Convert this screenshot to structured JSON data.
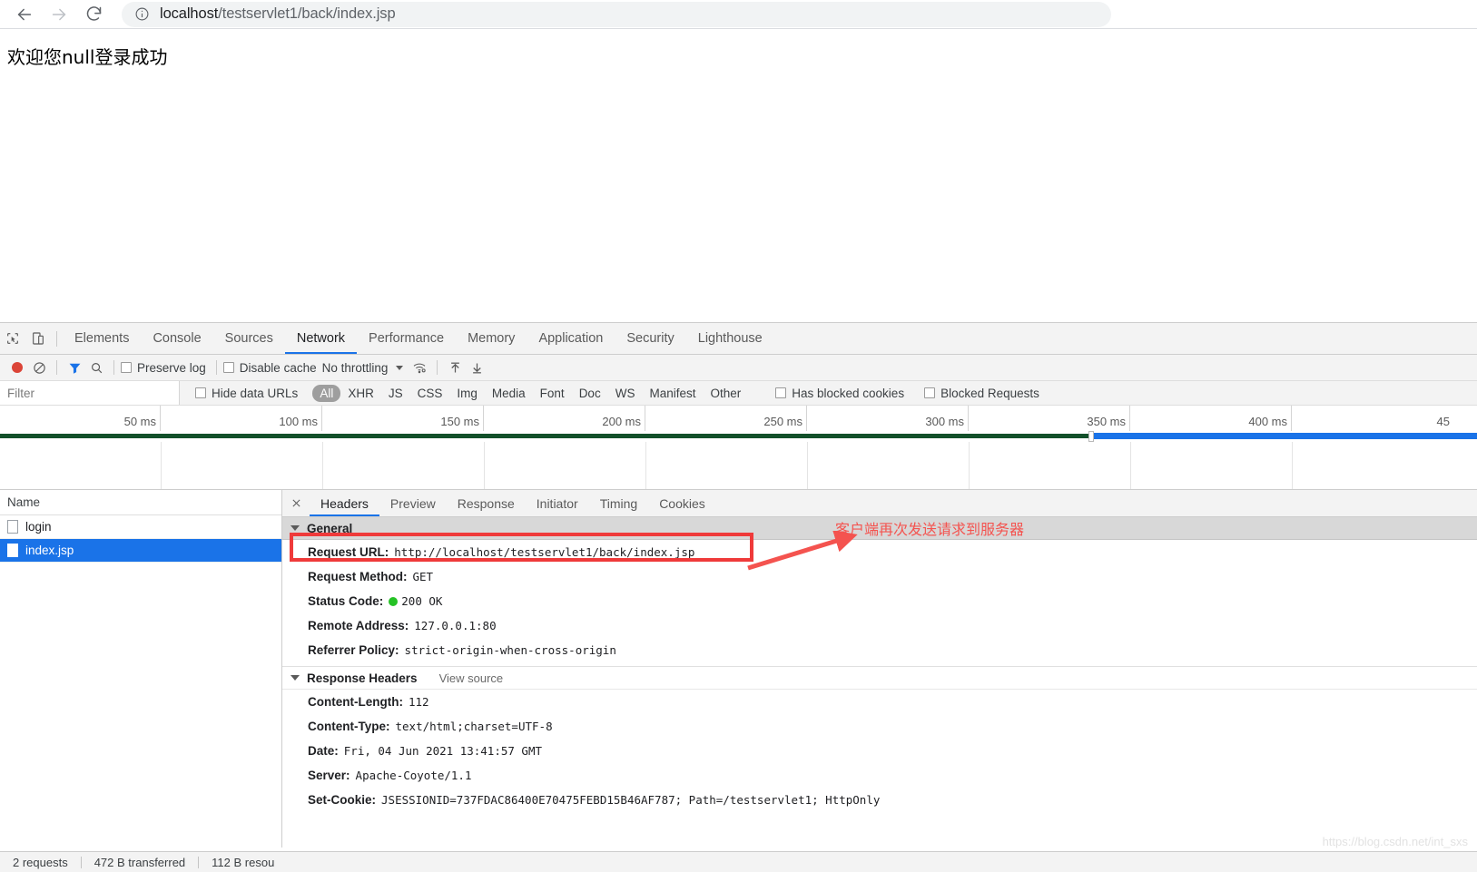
{
  "browser": {
    "back_tooltip": "Back",
    "forward_tooltip": "Forward",
    "reload_tooltip": "Reload",
    "omnibox": {
      "host": "localhost",
      "path": "/testservlet1/back/index.jsp",
      "full_url": "localhost/testservlet1/back/index.jsp"
    }
  },
  "page": {
    "body_text": "欢迎您null登录成功"
  },
  "devtools": {
    "panel_tabs": [
      {
        "label": "Elements",
        "active": false
      },
      {
        "label": "Console",
        "active": false
      },
      {
        "label": "Sources",
        "active": false
      },
      {
        "label": "Network",
        "active": true
      },
      {
        "label": "Performance",
        "active": false
      },
      {
        "label": "Memory",
        "active": false
      },
      {
        "label": "Application",
        "active": false
      },
      {
        "label": "Security",
        "active": false
      },
      {
        "label": "Lighthouse",
        "active": false
      }
    ],
    "controls": {
      "preserve_log": "Preserve log",
      "disable_cache": "Disable cache",
      "throttling": "No throttling"
    },
    "filterbar": {
      "filter_placeholder": "Filter",
      "filter_value": "",
      "hide_data_urls": "Hide data URLs",
      "types": [
        {
          "label": "All",
          "selected": true
        },
        {
          "label": "XHR",
          "selected": false
        },
        {
          "label": "JS",
          "selected": false
        },
        {
          "label": "CSS",
          "selected": false
        },
        {
          "label": "Img",
          "selected": false
        },
        {
          "label": "Media",
          "selected": false
        },
        {
          "label": "Font",
          "selected": false
        },
        {
          "label": "Doc",
          "selected": false
        },
        {
          "label": "WS",
          "selected": false
        },
        {
          "label": "Manifest",
          "selected": false
        },
        {
          "label": "Other",
          "selected": false
        }
      ],
      "has_blocked_cookies": "Has blocked cookies",
      "blocked_requests": "Blocked Requests"
    },
    "overview": {
      "ticks": [
        "50 ms",
        "100 ms",
        "150 ms",
        "200 ms",
        "250 ms",
        "300 ms",
        "350 ms",
        "400 ms",
        "45"
      ],
      "bars": [
        {
          "name": "request-1-bar",
          "color": "#12502a",
          "left_pct": 0.0,
          "width_pct": 76.8
        },
        {
          "name": "request-2-bar",
          "color": "#1a73e8",
          "left_pct": 74.0,
          "width_pct": 26.0
        }
      ]
    },
    "request_list": {
      "column_header": "Name",
      "rows": [
        {
          "name": "login",
          "selected": false
        },
        {
          "name": "index.jsp",
          "selected": true
        }
      ]
    },
    "details": {
      "tabs": [
        {
          "label": "Headers",
          "active": true
        },
        {
          "label": "Preview",
          "active": false
        },
        {
          "label": "Response",
          "active": false
        },
        {
          "label": "Initiator",
          "active": false
        },
        {
          "label": "Timing",
          "active": false
        },
        {
          "label": "Cookies",
          "active": false
        }
      ],
      "general": {
        "title": "General",
        "rows": [
          {
            "name": "Request URL:",
            "value": "http://localhost/testservlet1/back/index.jsp",
            "highlighted": true
          },
          {
            "name": "Request Method:",
            "value": "GET"
          },
          {
            "name": "Status Code:",
            "value": "200  OK",
            "status_ok": true
          },
          {
            "name": "Remote Address:",
            "value": "127.0.0.1:80"
          },
          {
            "name": "Referrer Policy:",
            "value": "strict-origin-when-cross-origin"
          }
        ]
      },
      "response_headers": {
        "title": "Response Headers",
        "view_source": "View source",
        "rows": [
          {
            "name": "Content-Length:",
            "value": "112"
          },
          {
            "name": "Content-Type:",
            "value": "text/html;charset=UTF-8"
          },
          {
            "name": "Date:",
            "value": "Fri, 04 Jun 2021 13:41:57 GMT"
          },
          {
            "name": "Server:",
            "value": "Apache-Coyote/1.1"
          },
          {
            "name": "Set-Cookie:",
            "value": "JSESSIONID=737FDAC86400E70475FEBD15B46AF787; Path=/testservlet1; HttpOnly"
          }
        ]
      }
    },
    "statusbar": {
      "requests": "2 requests",
      "transferred": "472 B transferred",
      "resources": "112 B resou"
    }
  },
  "annotation": {
    "text": "客户端再次发送请求到服务器",
    "color": "#f4534f"
  },
  "watermark": "https://blog.csdn.net/int_sxs",
  "colors": {
    "accent": "#1a73e8",
    "annotation_red": "#f4534f",
    "highlight_red": "#ef3a3a",
    "status_green": "#25c225",
    "record_red": "#db4437"
  }
}
